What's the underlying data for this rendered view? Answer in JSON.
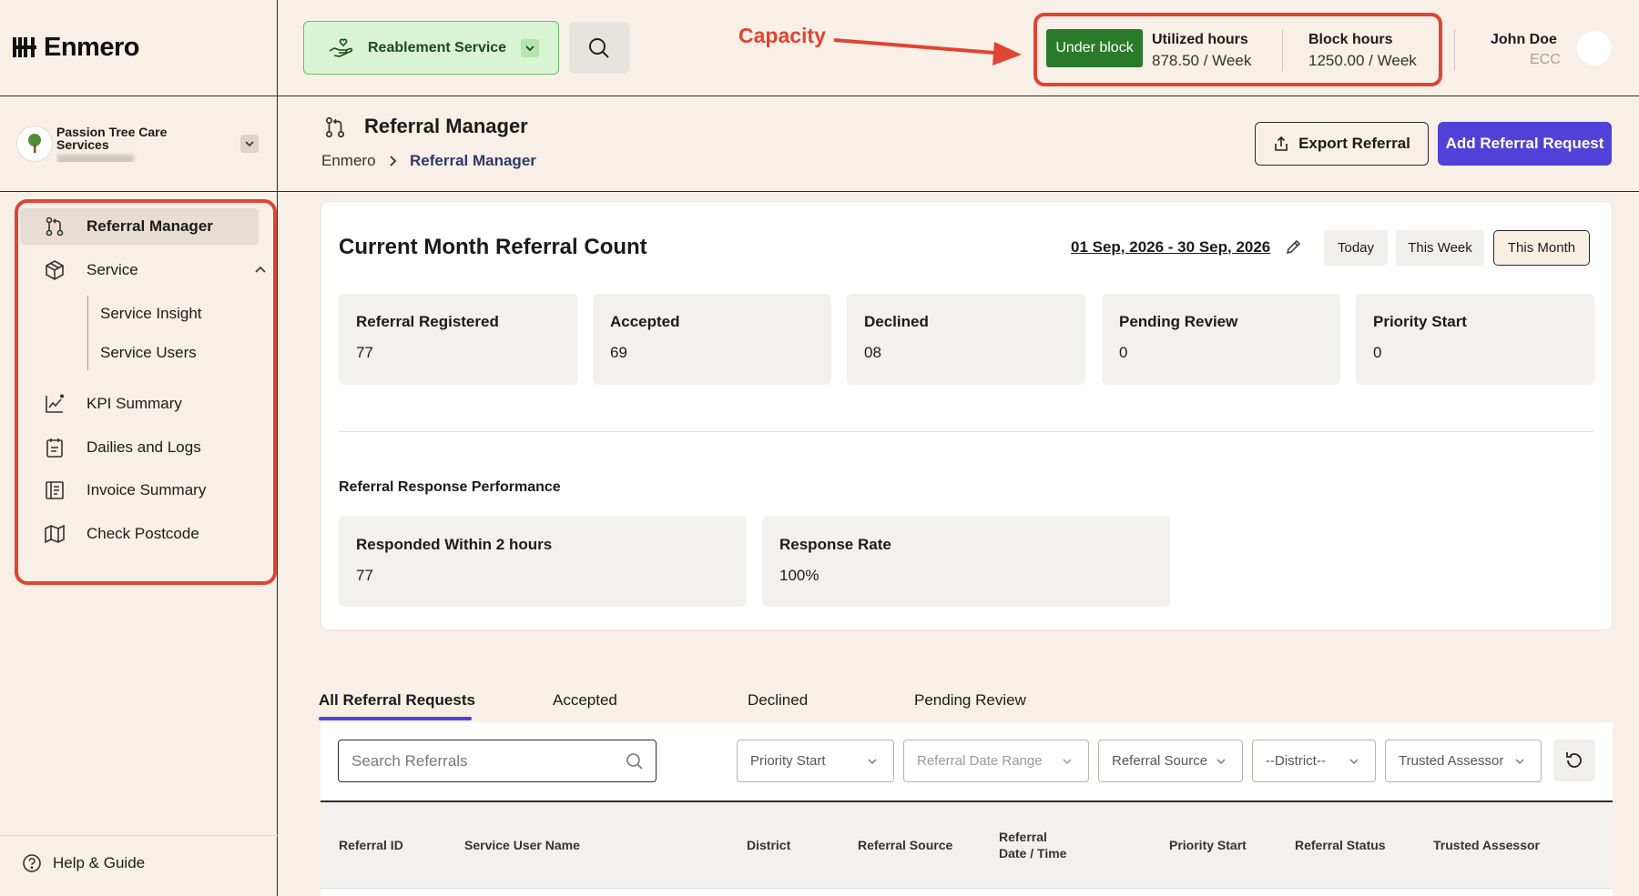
{
  "app": {
    "logo_text": "Enmero"
  },
  "org": {
    "name": "Passion Tree Care Services"
  },
  "sidebar": {
    "items": [
      {
        "label": "Referral Manager"
      },
      {
        "label": "Service"
      },
      {
        "label": "KPI Summary"
      },
      {
        "label": "Dailies and Logs"
      },
      {
        "label": "Invoice Summary"
      },
      {
        "label": "Check Postcode"
      }
    ],
    "service_sub": [
      {
        "label": "Service Insight"
      },
      {
        "label": "Service Users"
      }
    ],
    "help_label": "Help & Guide"
  },
  "header": {
    "service_label": "Reablement Service",
    "annotation": "Capacity",
    "capacity": {
      "status_label": "Under block",
      "utilized_title": "Utilized hours",
      "utilized_value": "878.50 / Week",
      "block_title": "Block hours",
      "block_value": "1250.00 / Week"
    },
    "user": {
      "name": "John Doe",
      "role": "ECC"
    }
  },
  "page": {
    "title": "Referral Manager",
    "breadcrumb": {
      "home": "Enmero",
      "current": "Referral Manager"
    },
    "export_label": "Export Referral",
    "add_label": "Add Referral Request"
  },
  "stats": {
    "title": "Current Month Referral Count",
    "date_range": "01 Sep, 2026 - 30 Sep, 2026",
    "periods": [
      {
        "label": "Today"
      },
      {
        "label": "This Week"
      },
      {
        "label": "This Month"
      }
    ],
    "cards": [
      {
        "label": "Referral Registered",
        "value": "77"
      },
      {
        "label": "Accepted",
        "value": "69"
      },
      {
        "label": "Declined",
        "value": "08"
      },
      {
        "label": "Pending Review",
        "value": "0"
      },
      {
        "label": "Priority Start",
        "value": "0"
      }
    ],
    "performance_title": "Referral Response Performance",
    "performance": [
      {
        "label": "Responded Within 2 hours",
        "value": "77"
      },
      {
        "label": "Response Rate",
        "value": "100%"
      }
    ]
  },
  "tabs": [
    {
      "label": "All Referral Requests"
    },
    {
      "label": "Accepted"
    },
    {
      "label": "Declined"
    },
    {
      "label": "Pending Review"
    }
  ],
  "filters": {
    "search_placeholder": "Search Referrals",
    "dropdowns": [
      {
        "label": "Priority Start"
      },
      {
        "label": "Referral Date Range"
      },
      {
        "label": "Referral Source"
      },
      {
        "label": "--District--"
      },
      {
        "label": "Trusted Assessor"
      }
    ]
  },
  "table": {
    "columns": [
      "Referral ID",
      "Service User Name",
      "District",
      "Referral Source",
      "Referral",
      "Date / Time",
      "Priority Start",
      "Referral Status",
      "Trusted Assessor"
    ]
  },
  "colors": {
    "accent": "#5042d8",
    "annotation": "#e04432",
    "status_green": "#2a7a2a",
    "service_bg": "#d9f4d3"
  }
}
